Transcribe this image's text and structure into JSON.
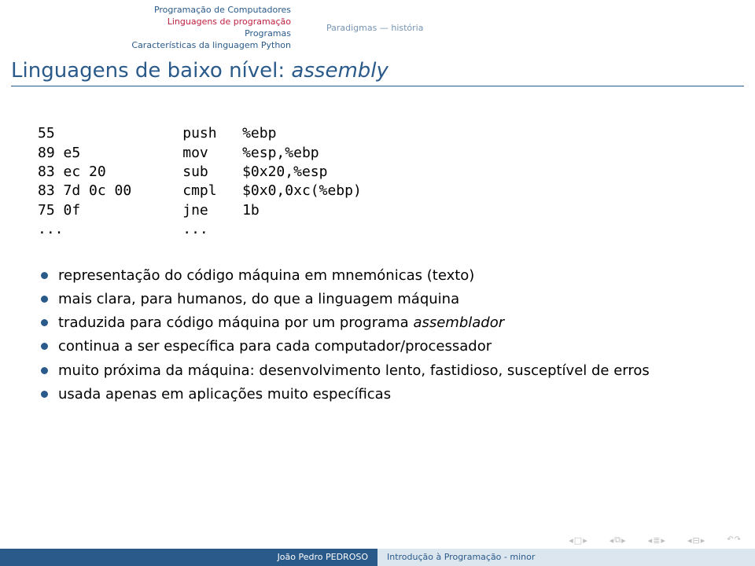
{
  "header": {
    "nav": [
      "Programação de Computadores",
      "Linguagens de programação",
      "Programas",
      "Características da linguagem Python"
    ],
    "activeIndex": 1,
    "subnav": "Paradigmas — história"
  },
  "title": {
    "prefix": "Linguagens de baixo nível: ",
    "italic": "assembly"
  },
  "asm": "55               push   %ebp\n89 e5            mov    %esp,%ebp\n83 ec 20         sub    $0x20,%esp\n83 7d 0c 00      cmpl   $0x0,0xc(%ebp)\n75 0f            jne    1b\n...              ...",
  "bullets": [
    {
      "text": "representação do código máquina em mnemónicas (texto)"
    },
    {
      "text": "mais clara, para humanos, do que a linguagem máquina"
    },
    {
      "prefix": "traduzida para código máquina por um programa ",
      "italic": "assemblador"
    },
    {
      "text": "continua a ser específica para cada computador/processador"
    },
    {
      "text": "muito próxima da máquina: desenvolvimento lento, fastidioso, susceptível de erros"
    },
    {
      "text": "usada apenas em aplicações muito específicas"
    }
  ],
  "footer": {
    "author": "João Pedro PEDROSO",
    "course": "Introdução à Programação - minor"
  }
}
